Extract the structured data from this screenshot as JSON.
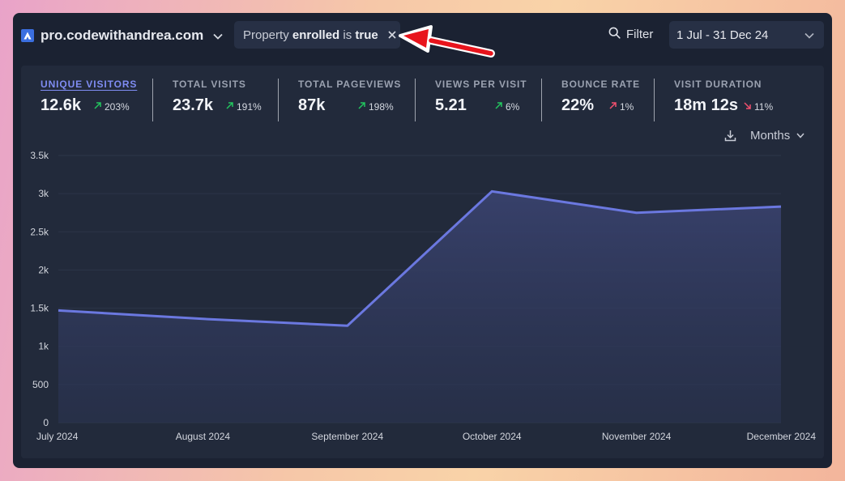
{
  "header": {
    "site_name": "pro.codewithandrea.com",
    "filter_pill": {
      "property_word": "Property",
      "key": "enrolled",
      "op": "is",
      "value": "true"
    },
    "filter_label": "Filter",
    "date_range": "1 Jul - 31 Dec 24"
  },
  "stats": [
    {
      "label": "UNIQUE VISITORS",
      "value": "12.6k",
      "change": "203%",
      "direction": "up",
      "active": true
    },
    {
      "label": "TOTAL VISITS",
      "value": "23.7k",
      "change": "191%",
      "direction": "up",
      "active": false
    },
    {
      "label": "TOTAL PAGEVIEWS",
      "value": "87k",
      "change": "198%",
      "direction": "up",
      "active": false
    },
    {
      "label": "VIEWS PER VISIT",
      "value": "5.21",
      "change": "6%",
      "direction": "up",
      "active": false
    },
    {
      "label": "BOUNCE RATE",
      "value": "22%",
      "change": "1%",
      "direction": "up-bad",
      "active": false
    },
    {
      "label": "VISIT DURATION",
      "value": "18m 12s",
      "change": "11%",
      "direction": "down-bad",
      "active": false
    }
  ],
  "interval_label": "Months",
  "colors": {
    "accent": "#6b78e0",
    "positive": "#22c55e",
    "negative": "#f1506e",
    "annotation_arrow": "#e8141c"
  },
  "chart_data": {
    "type": "area",
    "categories": [
      "July 2024",
      "August 2024",
      "September 2024",
      "October 2024",
      "November 2024",
      "December 2024"
    ],
    "values": [
      1470,
      1360,
      1270,
      3030,
      2750,
      2830
    ],
    "yticks": [
      "0",
      "500",
      "1k",
      "1.5k",
      "2k",
      "2.5k",
      "3k",
      "3.5k"
    ],
    "ylim": [
      0,
      3500
    ],
    "grid": true
  }
}
